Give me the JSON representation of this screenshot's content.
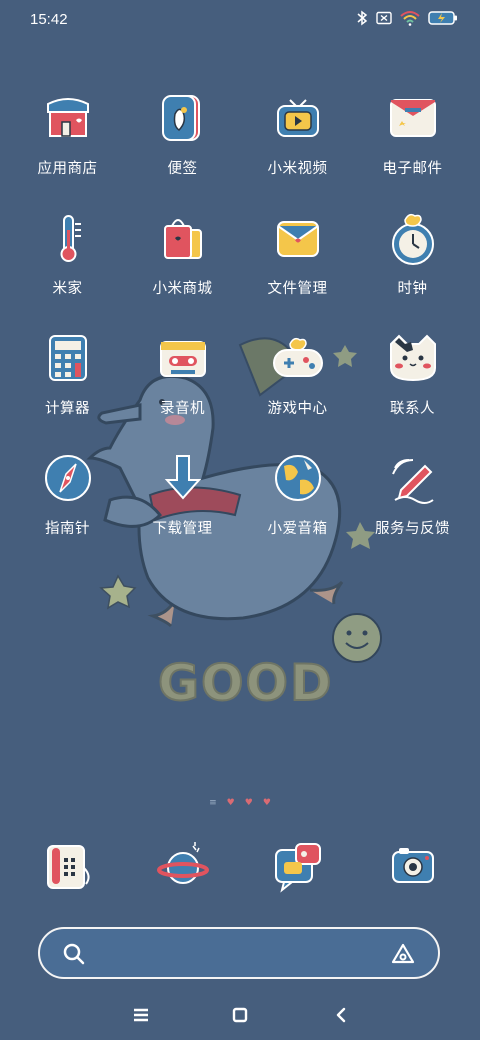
{
  "status_bar": {
    "time": "15:42",
    "icons": [
      "bluetooth-icon",
      "sim-off-icon",
      "wifi-icon",
      "battery-charging-icon"
    ]
  },
  "apps": [
    {
      "label": "应用商店",
      "icon": "app-store-icon"
    },
    {
      "label": "便签",
      "icon": "notes-icon"
    },
    {
      "label": "小米视频",
      "icon": "video-icon"
    },
    {
      "label": "电子邮件",
      "icon": "email-icon"
    },
    {
      "label": "米家",
      "icon": "thermometer-icon"
    },
    {
      "label": "小米商城",
      "icon": "shopping-bag-icon"
    },
    {
      "label": "文件管理",
      "icon": "folder-icon"
    },
    {
      "label": "时钟",
      "icon": "clock-icon"
    },
    {
      "label": "计算器",
      "icon": "calculator-icon"
    },
    {
      "label": "录音机",
      "icon": "cassette-icon"
    },
    {
      "label": "游戏中心",
      "icon": "gamepad-icon"
    },
    {
      "label": "联系人",
      "icon": "cat-face-icon"
    },
    {
      "label": "指南针",
      "icon": "compass-icon"
    },
    {
      "label": "下载管理",
      "icon": "download-arrow-icon"
    },
    {
      "label": "小爱音箱",
      "icon": "globe-speaker-icon"
    },
    {
      "label": "服务与反馈",
      "icon": "feedback-pen-icon"
    }
  ],
  "dock": [
    {
      "icon": "phone-icon"
    },
    {
      "icon": "planet-browser-icon"
    },
    {
      "icon": "messages-icon"
    },
    {
      "icon": "camera-icon"
    }
  ],
  "wallpaper": {
    "text": "GOOD",
    "colors": {
      "background": "#465e7d",
      "goose": "#6f88a3",
      "star": "#a7b28c"
    }
  },
  "pager": {
    "pages": 4,
    "current": 1
  },
  "nav": {
    "buttons": [
      "menu-icon",
      "home-icon",
      "back-icon"
    ]
  },
  "colors": {
    "accent_red": "#e0545f",
    "accent_yellow": "#f4c64a",
    "accent_blue": "#3f7fb0"
  }
}
